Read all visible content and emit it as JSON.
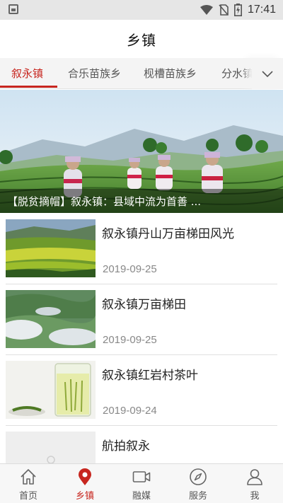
{
  "status_bar": {
    "time": "17:41"
  },
  "header": {
    "title": "乡镇"
  },
  "tabs": [
    {
      "label": "叙永镇",
      "active": true
    },
    {
      "label": "合乐苗族乡",
      "active": false
    },
    {
      "label": "枧槽苗族乡",
      "active": false
    },
    {
      "label": "分水镇",
      "active": false
    }
  ],
  "banner": {
    "caption": "【脱贫摘帽】叙永镇：县域中流为首善 ..."
  },
  "news": [
    {
      "title": "叙永镇丹山万亩梯田风光",
      "date": "2019-09-25"
    },
    {
      "title": "叙永镇万亩梯田",
      "date": "2019-09-25"
    },
    {
      "title": "叙永镇红岩村茶叶",
      "date": "2019-09-24"
    },
    {
      "title": "航拍叙永",
      "date": ""
    }
  ],
  "bottom_nav": [
    {
      "label": "首页",
      "icon": "home-icon",
      "active": false
    },
    {
      "label": "乡镇",
      "icon": "location-pin-icon",
      "active": true
    },
    {
      "label": "融媒",
      "icon": "video-camera-icon",
      "active": false
    },
    {
      "label": "服务",
      "icon": "compass-icon",
      "active": false
    },
    {
      "label": "我",
      "icon": "user-icon",
      "active": false
    }
  ],
  "colors": {
    "accent": "#c7261f",
    "tab_bar_bg": "#f4f4f4",
    "nav_bg": "#f7f7f7"
  }
}
